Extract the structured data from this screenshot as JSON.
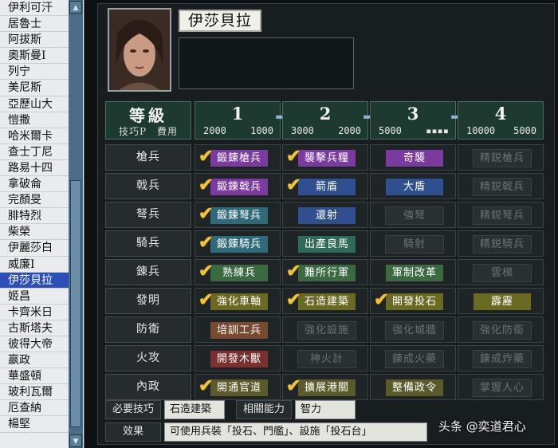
{
  "officer_list": {
    "items": [
      "伊利可汗",
      "居魯士",
      "阿拔斯",
      "奧斯曼Ⅰ",
      "列宁",
      "美尼斯",
      "亞歷山大",
      "愷撒",
      "哈米爾卡",
      "查士丁尼",
      "路易十四",
      "拿破侖",
      "完顏旻",
      "腓特烈",
      "柴榮",
      "伊麗莎白",
      "威廉Ⅰ",
      "伊莎貝拉",
      "姬昌",
      "卡齊米日",
      "古斯塔夫",
      "彼得大帝",
      "嬴政",
      "華盛頓",
      "玻利瓦爾",
      "厄查納",
      "楊堅"
    ],
    "selected_index": 17
  },
  "scrollbar": {
    "up_icon": "▲",
    "down_icon": "▼"
  },
  "officer": {
    "name": "伊莎貝拉",
    "portrait": "portrait"
  },
  "table": {
    "header_title": "等級",
    "header_sub": "技巧P　費用",
    "levels": [
      {
        "num": "1",
        "tp": "2000",
        "cost": "1000"
      },
      {
        "num": "2",
        "tp": "3000",
        "cost": "2000"
      },
      {
        "num": "3",
        "tp": "5000",
        "cost": "▪▪▪▪"
      },
      {
        "num": "4",
        "tp": "10000",
        "cost": "5000"
      }
    ],
    "arrow_icon": "➡",
    "rows": [
      {
        "category": "槍兵",
        "cells": [
          {
            "label": "鍛錬槍兵",
            "done": true,
            "color": "#7a3aa0"
          },
          {
            "label": "襲擊兵糧",
            "done": true,
            "color": "#7a3aa0"
          },
          {
            "label": "奇襲",
            "done": false,
            "color": "#7a3aa0"
          },
          {
            "label": "精鋭槍兵",
            "done": false,
            "color": "dim"
          }
        ]
      },
      {
        "category": "戟兵",
        "cells": [
          {
            "label": "鍛錬戟兵",
            "done": true,
            "color": "#7a3aa0"
          },
          {
            "label": "箭盾",
            "done": true,
            "color": "#2f4f8f"
          },
          {
            "label": "大盾",
            "done": false,
            "color": "#2f4f8f"
          },
          {
            "label": "精鋭戟兵",
            "done": false,
            "color": "dim"
          }
        ]
      },
      {
        "category": "弩兵",
        "cells": [
          {
            "label": "鍛錬弩兵",
            "done": true,
            "color": "#2f6a7a"
          },
          {
            "label": "還射",
            "done": false,
            "color": "#2f4f8f"
          },
          {
            "label": "強弩",
            "done": false,
            "color": "dim"
          },
          {
            "label": "精鋭弩兵",
            "done": false,
            "color": "dim"
          }
        ]
      },
      {
        "category": "騎兵",
        "cells": [
          {
            "label": "鍛錬騎兵",
            "done": true,
            "color": "#2f6a7a"
          },
          {
            "label": "出產良馬",
            "done": false,
            "color": "#2f6a58"
          },
          {
            "label": "騎射",
            "done": false,
            "color": "dim"
          },
          {
            "label": "精鋭騎兵",
            "done": false,
            "color": "dim"
          }
        ]
      },
      {
        "category": "錬兵",
        "cells": [
          {
            "label": "熟練兵",
            "done": true,
            "color": "#3a6a40"
          },
          {
            "label": "難所行軍",
            "done": true,
            "color": "#3a6a40"
          },
          {
            "label": "軍制改革",
            "done": false,
            "color": "#3a6a40"
          },
          {
            "label": "雲梯",
            "done": false,
            "color": "dim"
          }
        ]
      },
      {
        "category": "發明",
        "cells": [
          {
            "label": "強化車軸",
            "done": true,
            "color": "#6a6a24"
          },
          {
            "label": "石造建築",
            "done": true,
            "color": "#6a6a24"
          },
          {
            "label": "開發投石",
            "done": true,
            "color": "#6a6a24"
          },
          {
            "label": "霹靂",
            "done": false,
            "color": "#6a6a24"
          }
        ]
      },
      {
        "category": "防衛",
        "cells": [
          {
            "label": "培訓工兵",
            "done": false,
            "color": "#7a4a30"
          },
          {
            "label": "強化設施",
            "done": false,
            "color": "dim"
          },
          {
            "label": "強化城牆",
            "done": false,
            "color": "dim"
          },
          {
            "label": "強化防衛",
            "done": false,
            "color": "dim"
          }
        ]
      },
      {
        "category": "火攻",
        "cells": [
          {
            "label": "開發木獸",
            "done": false,
            "color": "#7a3030"
          },
          {
            "label": "神火計",
            "done": false,
            "color": "dim"
          },
          {
            "label": "錬成火藥",
            "done": false,
            "color": "dim"
          },
          {
            "label": "錬成炸藥",
            "done": false,
            "color": "dim"
          }
        ]
      },
      {
        "category": "內政",
        "cells": [
          {
            "label": "開通官道",
            "done": true,
            "color": "#5a5a2a"
          },
          {
            "label": "擴展港關",
            "done": true,
            "color": "#5a5a2a"
          },
          {
            "label": "整備政令",
            "done": false,
            "color": "#5a5a2a"
          },
          {
            "label": "掌握人心",
            "done": false,
            "color": "dim"
          }
        ]
      }
    ]
  },
  "footer": {
    "required_label": "必要技巧",
    "required_value": "石造建築",
    "ability_label": "相關能力",
    "ability_value": "智力",
    "effect_label": "效果",
    "effect_value": "可使用兵裝「投石、門艦」、設施「投石台」"
  },
  "watermark": "头条 @奕道君心",
  "check_icon": "✔"
}
